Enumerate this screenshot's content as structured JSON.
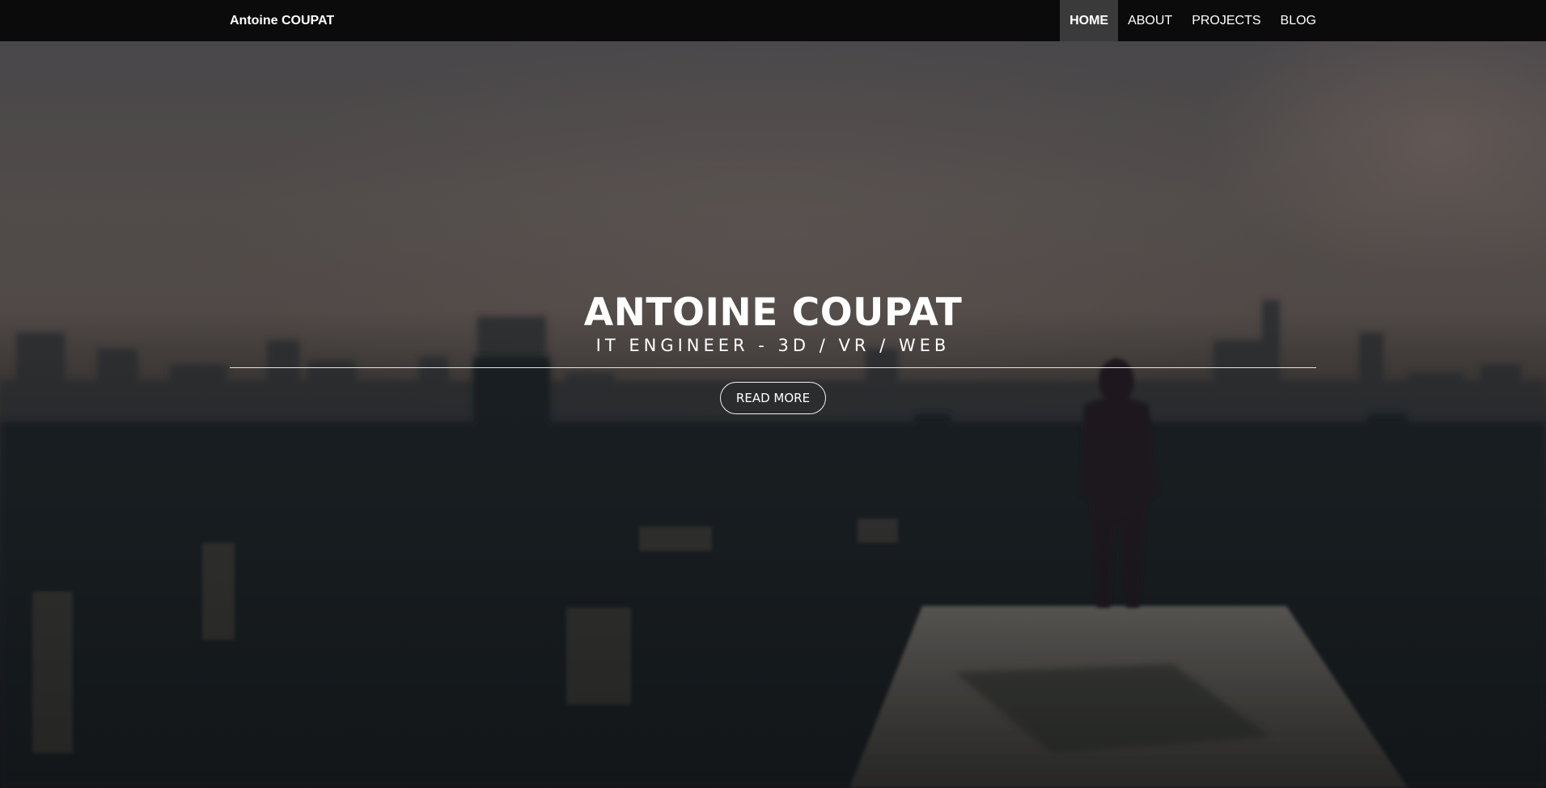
{
  "navbar": {
    "brand": "Antoine COUPAT",
    "items": [
      {
        "label": "HOME",
        "active": true
      },
      {
        "label": "ABOUT",
        "active": false
      },
      {
        "label": "PROJECTS",
        "active": false
      },
      {
        "label": "BLOG",
        "active": false
      }
    ]
  },
  "hero": {
    "title": "ANTOINE COUPAT",
    "subtitle": "IT ENGINEER - 3D / VR / WEB",
    "cta_label": "READ MORE"
  },
  "colors": {
    "navbar_bg": "#0b0b0b",
    "active_nav_bg": "#3a3a3a",
    "text": "#ffffff"
  }
}
